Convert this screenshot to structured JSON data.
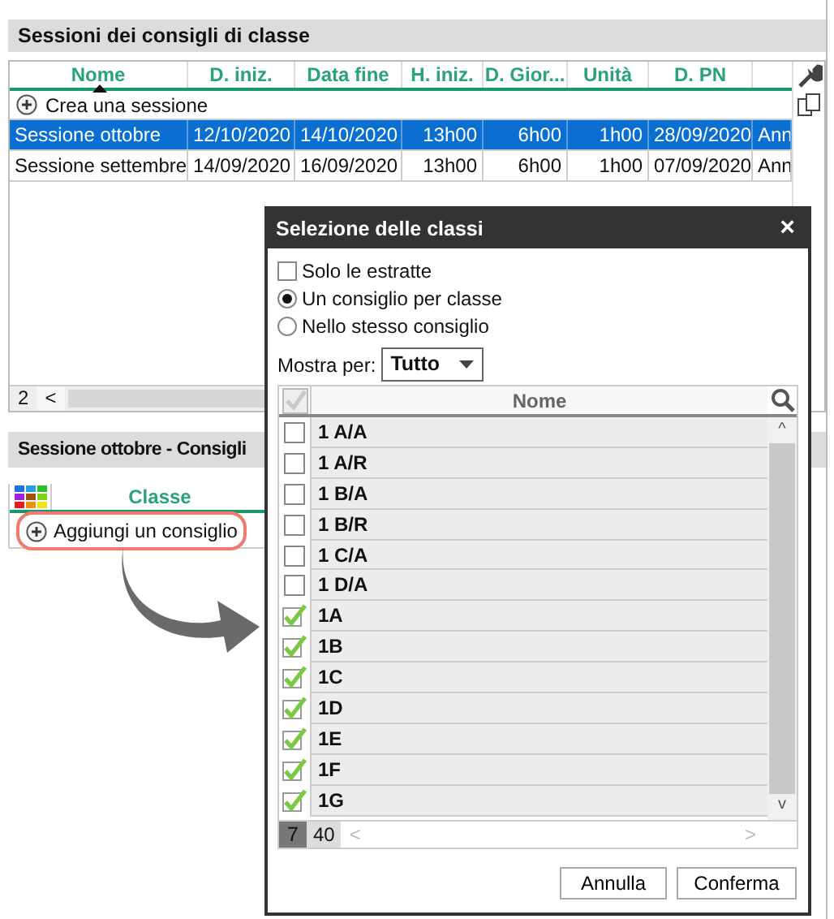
{
  "sessions_panel": {
    "title": "Sessioni dei consigli di classe",
    "columns": [
      {
        "label": "Nome",
        "sorted": true
      },
      {
        "label": "D. iniz.",
        "sorted": false
      },
      {
        "label": "Data fine",
        "sorted": false
      },
      {
        "label": "H. iniz.",
        "sorted": false
      },
      {
        "label": "D. Gior...",
        "sorted": false
      },
      {
        "label": "Unità",
        "sorted": false
      },
      {
        "label": "D. PN",
        "sorted": false
      }
    ],
    "add_label": "Crea una sessione",
    "rows": [
      {
        "selected": true,
        "cells": [
          "Sessione ottobre",
          "12/10/2020",
          "14/10/2020",
          "13h00",
          "6h00",
          "1h00",
          "28/09/2020",
          "Ann"
        ]
      },
      {
        "selected": false,
        "cells": [
          "Sessione settembre",
          "14/09/2020",
          "16/09/2020",
          "13h00",
          "6h00",
          "1h00",
          "07/09/2020",
          "Ann"
        ]
      }
    ],
    "count": "2",
    "scroll_left": "<"
  },
  "councils_panel": {
    "title": "Sessione ottobre - Consigli",
    "column": "Classe",
    "add_label": "Aggiungi un consiglio"
  },
  "dialog": {
    "title": "Selezione delle classi",
    "close": "×",
    "options": [
      {
        "kind": "checkbox",
        "label": "Solo le estratte",
        "checked": false
      },
      {
        "kind": "radio",
        "label": "Un consiglio per classe",
        "checked": true
      },
      {
        "kind": "radio",
        "label": "Nello stesso consiglio",
        "checked": false
      }
    ],
    "select_all": {
      "checked": true,
      "disabled": true
    },
    "show_by_label": "Mostra per:",
    "show_by_value": "Tutto",
    "column": "Nome",
    "classes": [
      {
        "name": "1 A/A",
        "checked": false
      },
      {
        "name": "1 A/R",
        "checked": false
      },
      {
        "name": "1 B/A",
        "checked": false
      },
      {
        "name": "1 B/R",
        "checked": false
      },
      {
        "name": "1 C/A",
        "checked": false
      },
      {
        "name": "1 D/A",
        "checked": false
      },
      {
        "name": "1A",
        "checked": true
      },
      {
        "name": "1B",
        "checked": true
      },
      {
        "name": "1C",
        "checked": true
      },
      {
        "name": "1D",
        "checked": true
      },
      {
        "name": "1E",
        "checked": true
      },
      {
        "name": "1F",
        "checked": true
      },
      {
        "name": "1G",
        "checked": true
      }
    ],
    "selected_count": "7",
    "total_count": "40",
    "scroll_up": "^",
    "scroll_down": "v",
    "scroll_left": "<",
    "scroll_right": ">",
    "buttons": [
      "Annulla",
      "Conferma"
    ]
  }
}
